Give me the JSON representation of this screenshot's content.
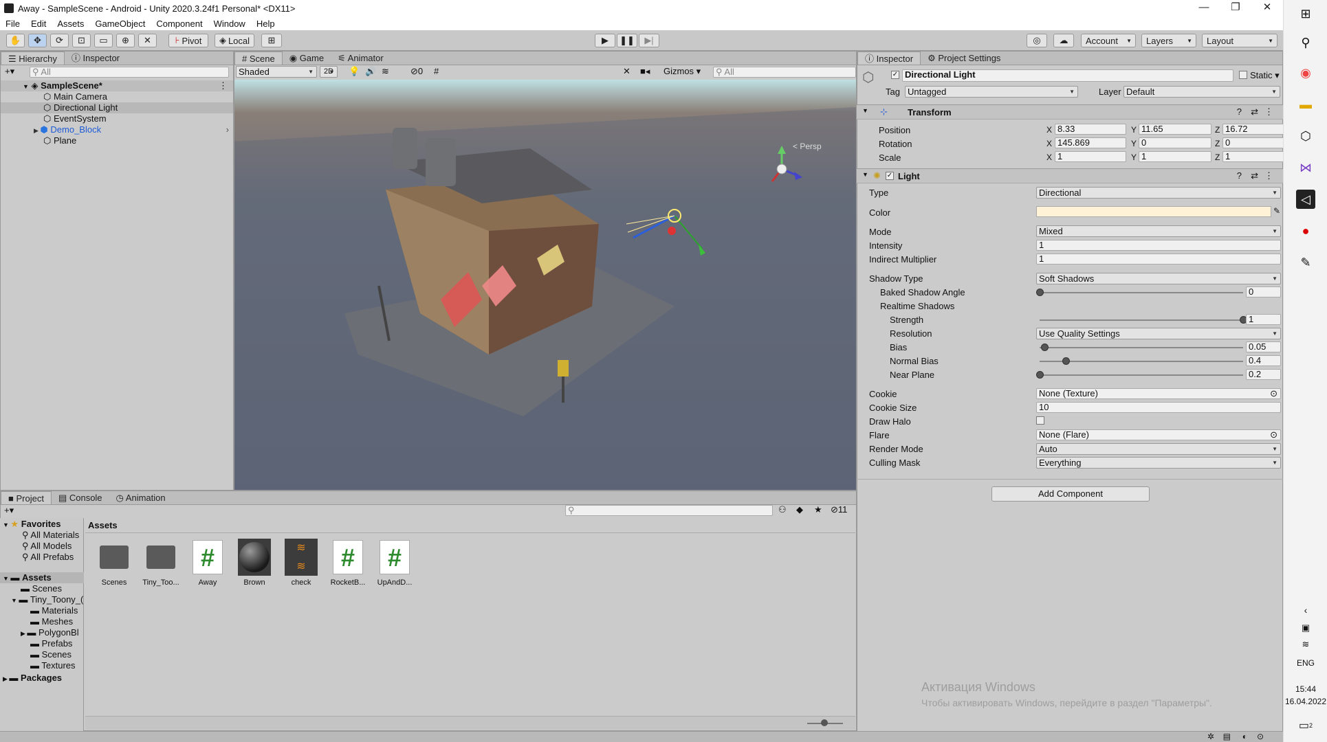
{
  "window": {
    "title": "Away - SampleScene - Android - Unity 2020.3.24f1 Personal* <DX11>",
    "controls": [
      "—",
      "❐",
      "✕"
    ]
  },
  "menu": [
    "File",
    "Edit",
    "Assets",
    "GameObject",
    "Component",
    "Window",
    "Help"
  ],
  "toolbar": {
    "pivot": "Pivot",
    "local": "Local",
    "account": "Account",
    "layers": "Layers",
    "layout": "Layout"
  },
  "hierarchy": {
    "tabs": [
      "Hierarchy",
      "Inspector"
    ],
    "search_placeholder": "All",
    "scene": "SampleScene*",
    "items": [
      "Main Camera",
      "Directional Light",
      "EventSystem",
      "Demo_Block",
      "Plane"
    ]
  },
  "scene_view": {
    "tabs": [
      "Scene",
      "Game",
      "Animator"
    ],
    "shading": "Shaded",
    "mode2d": "2D",
    "hidden_count": "0",
    "gizmos": "Gizmos",
    "search_placeholder": "All",
    "persp": "< Persp"
  },
  "inspector": {
    "tabs": [
      "Inspector",
      "Project Settings"
    ],
    "object_name": "Directional Light",
    "static": "Static",
    "tag_label": "Tag",
    "tag": "Untagged",
    "layer_label": "Layer",
    "layer": "Default",
    "transform": {
      "title": "Transform",
      "position_label": "Position",
      "rotation_label": "Rotation",
      "scale_label": "Scale",
      "position": {
        "x": "8.33",
        "y": "11.65",
        "z": "16.72"
      },
      "rotation": {
        "x": "145.869",
        "y": "0",
        "z": "0"
      },
      "scale": {
        "x": "1",
        "y": "1",
        "z": "1"
      }
    },
    "light": {
      "title": "Light",
      "type_label": "Type",
      "type": "Directional",
      "color_label": "Color",
      "color": "#fff2d6",
      "mode_label": "Mode",
      "mode": "Mixed",
      "intensity_label": "Intensity",
      "intensity": "1",
      "indirect_label": "Indirect Multiplier",
      "indirect": "1",
      "shadow_type_label": "Shadow Type",
      "shadow_type": "Soft Shadows",
      "baked_angle_label": "Baked Shadow Angle",
      "baked_angle": "0",
      "baked_angle_level": 0.0,
      "realtime_label": "Realtime Shadows",
      "strength_label": "Strength",
      "strength": "1",
      "strength_level": 1.0,
      "resolution_label": "Resolution",
      "resolution": "Use Quality Settings",
      "bias_label": "Bias",
      "bias": "0.05",
      "bias_level": 0.025,
      "normal_bias_label": "Normal Bias",
      "normal_bias": "0.4",
      "normal_bias_level": 0.13,
      "near_plane_label": "Near Plane",
      "near_plane": "0.2",
      "near_plane_level": 0.0,
      "cookie_label": "Cookie",
      "cookie": "None (Texture)",
      "cookie_size_label": "Cookie Size",
      "cookie_size": "10",
      "draw_halo_label": "Draw Halo",
      "flare_label": "Flare",
      "flare": "None (Flare)",
      "render_mode_label": "Render Mode",
      "render_mode": "Auto",
      "culling_label": "Culling Mask",
      "culling": "Everything"
    },
    "add_component": "Add Component"
  },
  "project": {
    "tabs": [
      "Project",
      "Console",
      "Animation"
    ],
    "hidden_count": "11",
    "favorites_label": "Favorites",
    "favorites": [
      "All Materials",
      "All Models",
      "All Prefabs"
    ],
    "assets_root": "Assets",
    "tree": [
      "Scenes",
      "Tiny_Toony_(",
      "Materials",
      "Meshes",
      "PolygonBl",
      "Prefabs",
      "Scenes",
      "Textures"
    ],
    "packages": "Packages",
    "breadcrumb": "Assets",
    "assets": [
      {
        "name": "Scenes",
        "kind": "folder"
      },
      {
        "name": "Tiny_Too...",
        "kind": "folder"
      },
      {
        "name": "Away",
        "kind": "script"
      },
      {
        "name": "Brown",
        "kind": "material"
      },
      {
        "name": "check",
        "kind": "audio"
      },
      {
        "name": "RocketB...",
        "kind": "script"
      },
      {
        "name": "UpAndD...",
        "kind": "script"
      }
    ]
  },
  "watermark": {
    "title": "Активация Windows",
    "subtitle": "Чтобы активировать Windows, перейдите в раздел \"Параметры\"."
  },
  "taskbar": {
    "lang": "ENG",
    "time": "15:44",
    "date": "16.04.2022",
    "notifications": "2"
  }
}
